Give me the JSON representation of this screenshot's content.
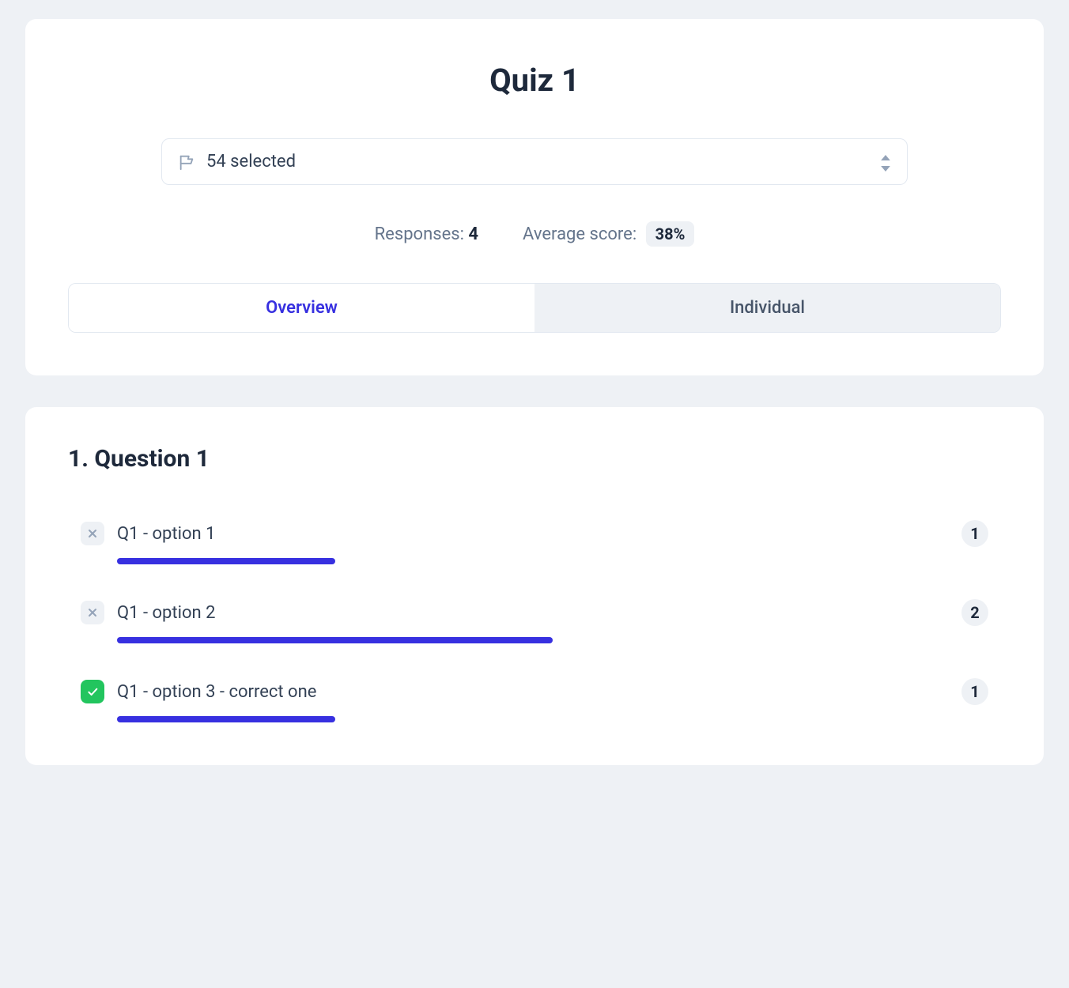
{
  "header": {
    "title": "Quiz 1",
    "selector": {
      "label": "54 selected"
    },
    "stats": {
      "responses_label": "Responses: ",
      "responses_value": "4",
      "avgscore_label": "Average score: ",
      "avgscore_value": "38%"
    },
    "tabs": {
      "overview": "Overview",
      "individual": "Individual"
    }
  },
  "question": {
    "title": "1. Question 1",
    "total_responses": 4,
    "options": [
      {
        "label": "Q1 - option 1",
        "correct": false,
        "count": "1",
        "bar_percent": 25
      },
      {
        "label": "Q1 - option 2",
        "correct": false,
        "count": "2",
        "bar_percent": 50
      },
      {
        "label": "Q1 - option 3 - correct one",
        "correct": true,
        "count": "1",
        "bar_percent": 25
      }
    ]
  },
  "colors": {
    "accent": "#3730e0",
    "correct": "#22c55e",
    "muted_bg": "#eef1f5"
  },
  "chart_data": {
    "type": "bar",
    "title": "1. Question 1",
    "categories": [
      "Q1 - option 1",
      "Q1 - option 2",
      "Q1 - option 3 - correct one"
    ],
    "values": [
      1,
      2,
      1
    ],
    "correct_flags": [
      false,
      false,
      true
    ],
    "xlabel": "",
    "ylabel": "Responses",
    "ylim": [
      0,
      4
    ]
  }
}
